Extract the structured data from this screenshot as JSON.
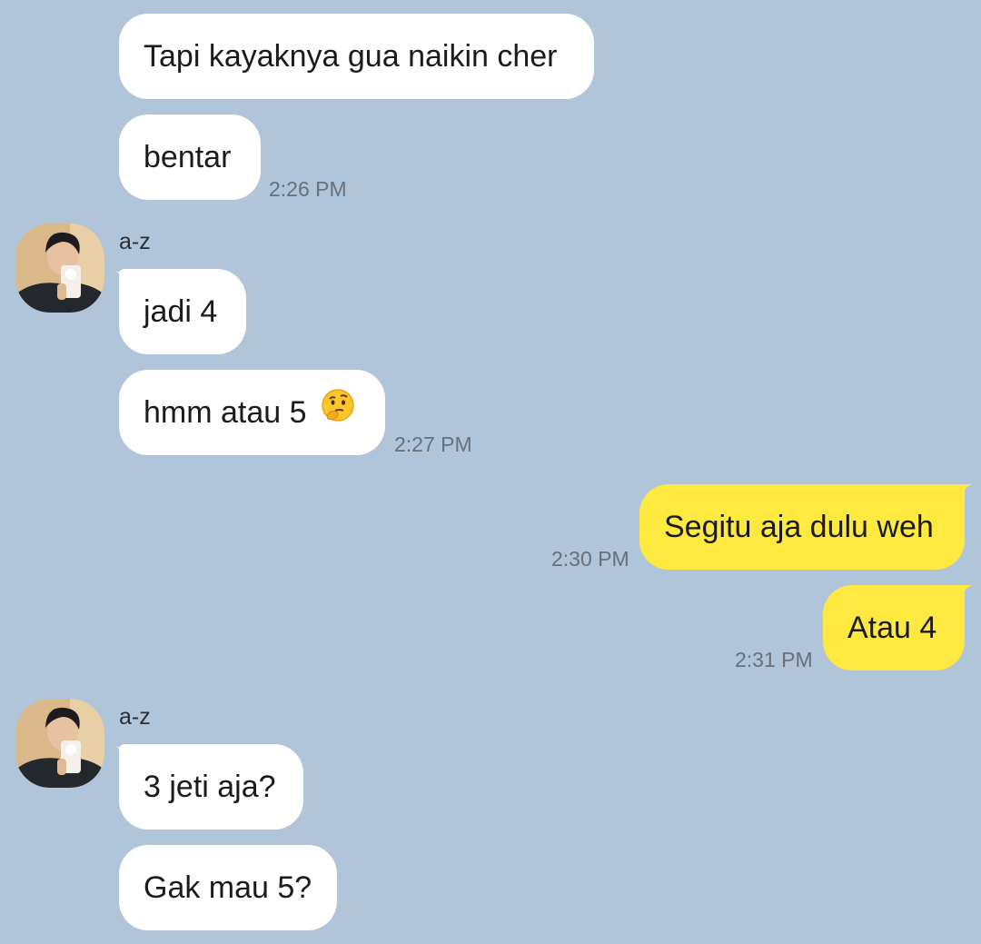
{
  "chat": {
    "messages": [
      {
        "sender": "",
        "text": "Tapi kayaknya gua naikin cher",
        "time": ""
      },
      {
        "sender": "",
        "text": "bentar",
        "time": "2:26 PM"
      },
      {
        "sender": "a-z",
        "text": "jadi 4",
        "time": ""
      },
      {
        "sender": "",
        "text": "hmm atau 5",
        "emoji": "thinking-face-emoji",
        "time": "2:27 PM"
      },
      {
        "sender": "me",
        "text": "Segitu aja dulu weh",
        "time": "2:30 PM"
      },
      {
        "sender": "me",
        "text": "Atau 4",
        "time": "2:31 PM"
      },
      {
        "sender": "a-z",
        "text": "3 jeti aja?",
        "time": ""
      },
      {
        "sender": "",
        "text": "Gak mau 5?",
        "time": ""
      }
    ]
  },
  "colors": {
    "background": "#b0c5d9",
    "incoming_bubble": "#ffffff",
    "outgoing_bubble": "#fee941",
    "timestamp": "#6a7079"
  }
}
